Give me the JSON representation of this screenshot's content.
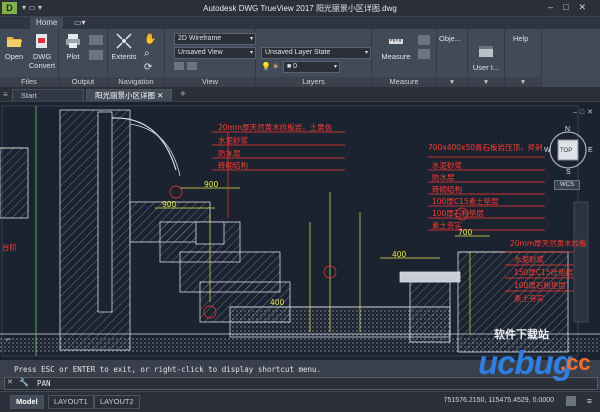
{
  "app": {
    "logo_letter": "D",
    "title": "Autodesk DWG TrueView 2017    阳光丽景小区详图.dwg",
    "quick_access": "▾ ▭ ▾"
  },
  "ribbon_tabs": [
    "Home"
  ],
  "ribbon": {
    "files": {
      "title": "Files",
      "open": "Open",
      "dwg_convert": "DWG Convert"
    },
    "output": {
      "title": "Output",
      "plot": "Plot"
    },
    "navigation": {
      "title": "Navigation",
      "extents": "Extents"
    },
    "view": {
      "title": "View",
      "visual_style": "2D Wireframe",
      "named_view": "Unsaved View"
    },
    "layers": {
      "title": "Layers",
      "layer_state": "Unsaved Layer State",
      "current_layer": "0",
      "layer_combo": "■ 0"
    },
    "measure": {
      "title": "Measure",
      "measure": "Measure"
    },
    "objects": {
      "title": "Obje..."
    },
    "user_interface": {
      "title": "User I..."
    },
    "help": {
      "title": "Help"
    }
  },
  "doc_tabs": [
    {
      "label": "Start"
    },
    {
      "label": "阳光丽景小区详图"
    }
  ],
  "drawing": {
    "notes": [
      "20mm厚天然黄木纹板岩，土黄色",
      "水泥砂浆",
      "防水层",
      "砖砌结构",
      "700x400x50青石板岩压顶，斧剁",
      "水泥砂浆",
      "防水层",
      "砖砌结构",
      "100厚C15素土垫层",
      "100厚石粉垫层",
      "素土夯实",
      "20mm厚天然黄木纹板",
      "水泥砂浆",
      "150厚C15砼垫层",
      "100厚石粉垫层",
      "素土夯实",
      "台阶"
    ],
    "dimensions": [
      "900",
      "900",
      "400",
      "700",
      "400"
    ],
    "viewcube": {
      "top": "TOP",
      "n": "N",
      "s": "S",
      "w": "W",
      "e": "E",
      "wcs": "WCS"
    }
  },
  "command": {
    "history": "Press ESC or ENTER to exit, or right-click to display shortcut menu.",
    "prompt": "PAN"
  },
  "layout_tabs": [
    "Model",
    "LAYOUT1",
    "LAYOUT2"
  ],
  "status": {
    "coordinates": "751576.2150, 115475.4529, 0.0000"
  },
  "watermark": {
    "sub": "软件下载站",
    "brand": "ucbug",
    "domain": ".cc"
  },
  "colors": {
    "canvas": "#1b2230",
    "annotation": "#ff3b30",
    "dimension": "#e8e84a",
    "hatch": "#9aa1ad",
    "accent": "#7fb24a"
  }
}
